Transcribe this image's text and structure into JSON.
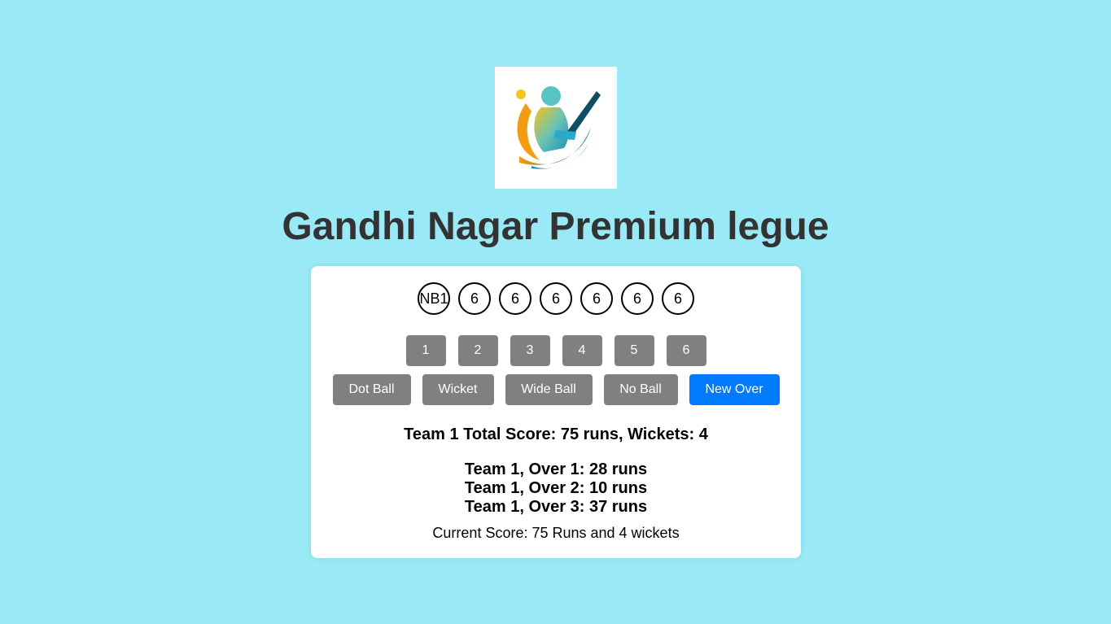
{
  "header": {
    "title": "Gandhi Nagar Premium legue",
    "logo_icon": "cricket-batsman-logo"
  },
  "over_balls": [
    "NB1",
    "6",
    "6",
    "6",
    "6",
    "6",
    "6"
  ],
  "run_buttons": [
    "1",
    "2",
    "3",
    "4",
    "5",
    "6"
  ],
  "actions": {
    "dot_ball": "Dot Ball",
    "wicket": "Wicket",
    "wide_ball": "Wide Ball",
    "no_ball": "No Ball",
    "new_over": "New Over"
  },
  "colors": {
    "background": "#99e9f6",
    "button": "#808080",
    "primary_button": "#007bff"
  },
  "score": {
    "total": "Team 1 Total Score: 75 runs, Wickets: 4",
    "overs": [
      "Team 1, Over 1: 28 runs",
      "Team 1, Over 2: 10 runs",
      "Team 1, Over 3: 37 runs"
    ],
    "current": "Current Score: 75 Runs and 4 wickets"
  }
}
